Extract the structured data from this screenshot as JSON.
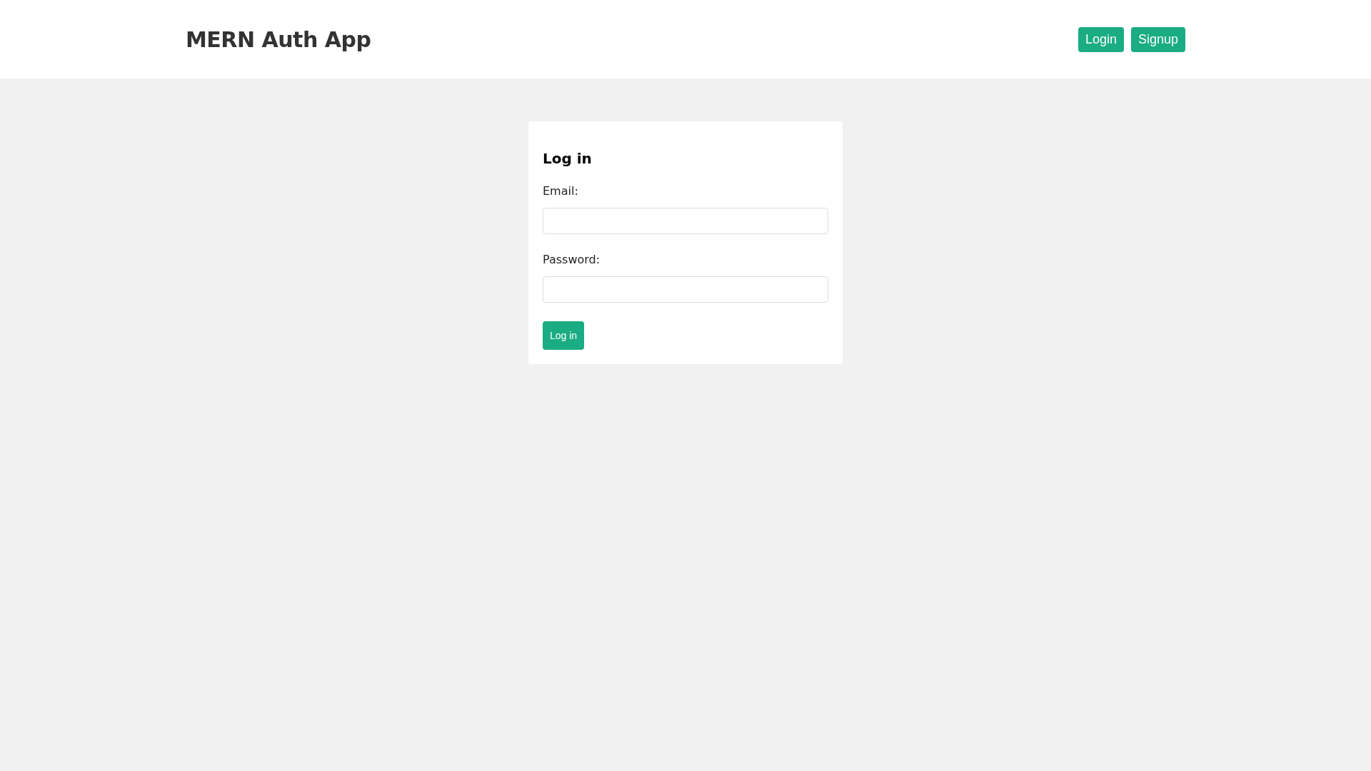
{
  "header": {
    "title": "MERN Auth App",
    "nav": [
      {
        "label": "Login"
      },
      {
        "label": "Signup"
      }
    ]
  },
  "form": {
    "heading": "Log in",
    "fields": [
      {
        "label": "Email:"
      },
      {
        "label": "Password:"
      }
    ],
    "submit": "Log in"
  }
}
